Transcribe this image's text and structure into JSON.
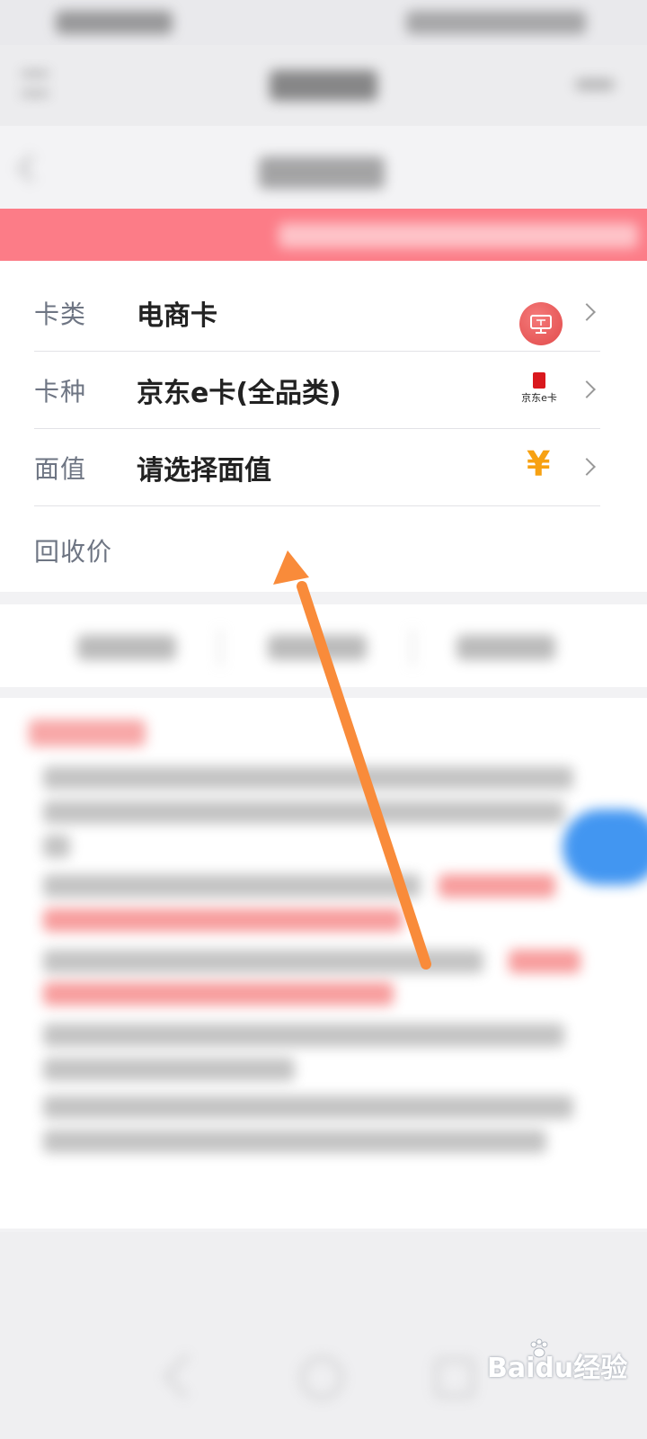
{
  "form": {
    "rows": [
      {
        "label": "卡类",
        "value": "电商卡",
        "icon": "monitor-icon"
      },
      {
        "label": "卡种",
        "value": "京东e卡(全品类)",
        "icon": "jd-ecard-icon",
        "icon_text": "京东e卡"
      },
      {
        "label": "面值",
        "value": "请选择面值",
        "icon": "yen-icon",
        "icon_text": "¥"
      }
    ],
    "recycle_price_label": "回收价"
  },
  "annotation": {
    "color": "#f98b3a"
  },
  "colors": {
    "notice_banner": "#fc7c87",
    "fab": "#2e8bf0",
    "yen": "#f7a112",
    "jd_red": "#d9181d",
    "label": "#6e7583"
  },
  "watermark": {
    "text": "Baidu经验"
  }
}
